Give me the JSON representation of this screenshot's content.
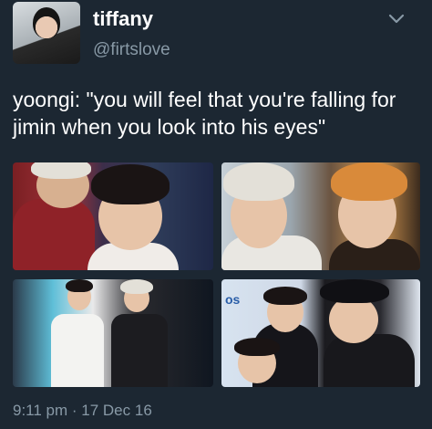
{
  "author": {
    "display_name": "tiffany",
    "handle": "@firtslove"
  },
  "tweet": {
    "text": "yoongi: \"you will feel that you're falling for jimin when you look into his eyes\""
  },
  "media": {
    "photo_text": "os"
  },
  "meta": {
    "timestamp": "9:11 pm · 17 Dec 16"
  },
  "icons": {
    "menu": "chevron-down-icon"
  },
  "colors": {
    "background": "#1c2732",
    "secondary_text": "#8899a6",
    "primary_text": "#ffffff"
  }
}
